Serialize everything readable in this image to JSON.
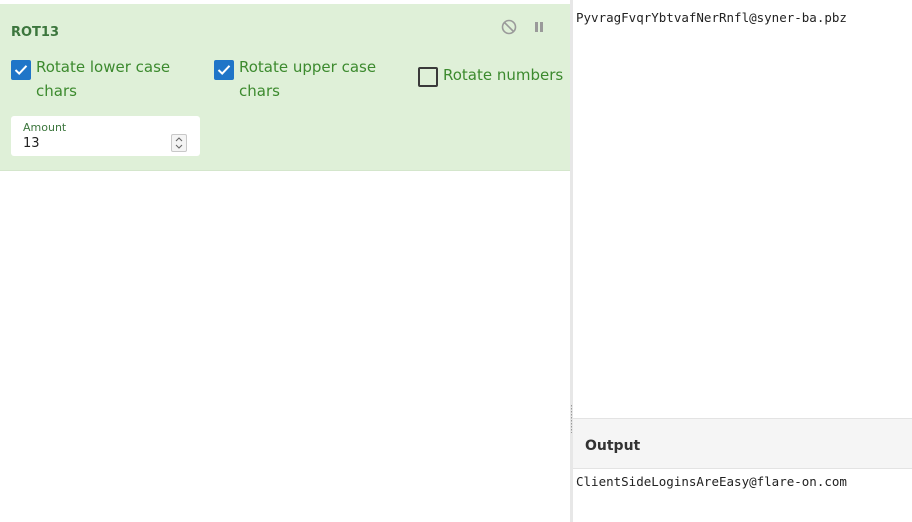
{
  "operation": {
    "title": "ROT13",
    "rotate_lower": {
      "label": "Rotate lower case chars",
      "checked": true
    },
    "rotate_upper": {
      "label": "Rotate upper case chars",
      "checked": true
    },
    "rotate_numbers": {
      "label": "Rotate numbers",
      "checked": false
    },
    "amount": {
      "label": "Amount",
      "value": "13"
    },
    "icons": {
      "disable": "disable-icon",
      "pause": "pause-icon"
    }
  },
  "input": {
    "text": "PyvragFvqrYbtvafNerRnfl@syner-ba.pbz"
  },
  "output": {
    "title": "Output",
    "text": "ClientSideLoginsAreEasy@flare-on.com"
  },
  "colors": {
    "card_bg": "#dff0d8",
    "title_green": "#3c763d",
    "label_green": "#3c8a2e",
    "checkbox_blue": "#1f75c8"
  }
}
